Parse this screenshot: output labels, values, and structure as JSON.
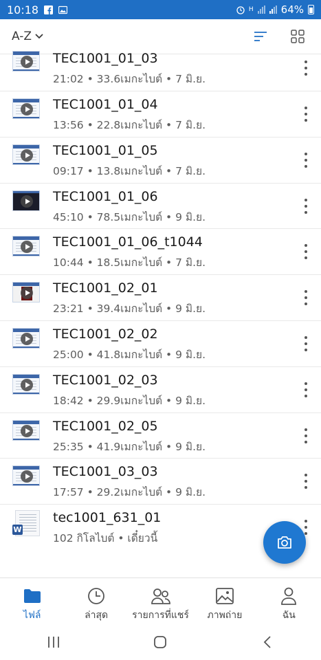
{
  "status_bar": {
    "time": "10:18",
    "battery": "64%",
    "network": "H",
    "icons": [
      "facebook-icon",
      "gallery-icon",
      "alarm-icon",
      "signal-icon",
      "battery-icon"
    ]
  },
  "toolbar": {
    "sort_label": "A-Z",
    "icons": [
      "chevron-down-icon",
      "sort-list-icon",
      "grid-view-icon"
    ]
  },
  "files": [
    {
      "name": "TEC1001_01_03",
      "meta": "21:02 • 33.6เมกะไบต์ • 7 มิ.ย.",
      "thumb": "slide"
    },
    {
      "name": "TEC1001_01_04",
      "meta": "13:56 • 22.8เมกะไบต์ • 7 มิ.ย.",
      "thumb": "slide"
    },
    {
      "name": "TEC1001_01_05",
      "meta": "09:17 • 13.8เมกะไบต์ • 7 มิ.ย.",
      "thumb": "slide"
    },
    {
      "name": "TEC1001_01_06",
      "meta": "45:10 • 78.5เมกะไบต์ • 9 มิ.ย.",
      "thumb": "dark"
    },
    {
      "name": "TEC1001_01_06_t1044",
      "meta": "10:44 • 18.5เมกะไบต์ • 7 มิ.ย.",
      "thumb": "slide"
    },
    {
      "name": "TEC1001_02_01",
      "meta": "23:21 • 39.4เมกะไบต์ • 9 มิ.ย.",
      "thumb": "photo"
    },
    {
      "name": "TEC1001_02_02",
      "meta": "25:00 • 41.8เมกะไบต์ • 9 มิ.ย.",
      "thumb": "slide"
    },
    {
      "name": "TEC1001_02_03",
      "meta": "18:42 • 29.9เมกะไบต์ • 9 มิ.ย.",
      "thumb": "slide"
    },
    {
      "name": "TEC1001_02_05",
      "meta": "25:35 • 41.9เมกะไบต์ • 9 มิ.ย.",
      "thumb": "slide"
    },
    {
      "name": "TEC1001_03_03",
      "meta": "17:57 • 29.2เมกะไบต์ • 9 มิ.ย.",
      "thumb": "slide"
    },
    {
      "name": "tec1001_631_01",
      "meta": "102 กิโลไบต์ • เดี๋ยวนี้",
      "thumb": "word"
    }
  ],
  "fab": {
    "icon": "camera-icon"
  },
  "bottom_nav": [
    {
      "label": "ไฟล์",
      "icon": "folder-icon",
      "active": true
    },
    {
      "label": "ล่าสุด",
      "icon": "clock-icon",
      "active": false
    },
    {
      "label": "รายการที่แชร์",
      "icon": "shared-people-icon",
      "active": false
    },
    {
      "label": "ภาพถ่าย",
      "icon": "photo-icon",
      "active": false
    },
    {
      "label": "ฉัน",
      "icon": "person-icon",
      "active": false
    }
  ],
  "system_nav": [
    "recent-apps-icon",
    "home-icon",
    "back-icon"
  ],
  "colors": {
    "accent": "#1f6fc5",
    "fab": "#1f78d1",
    "word": "#2b579a"
  }
}
